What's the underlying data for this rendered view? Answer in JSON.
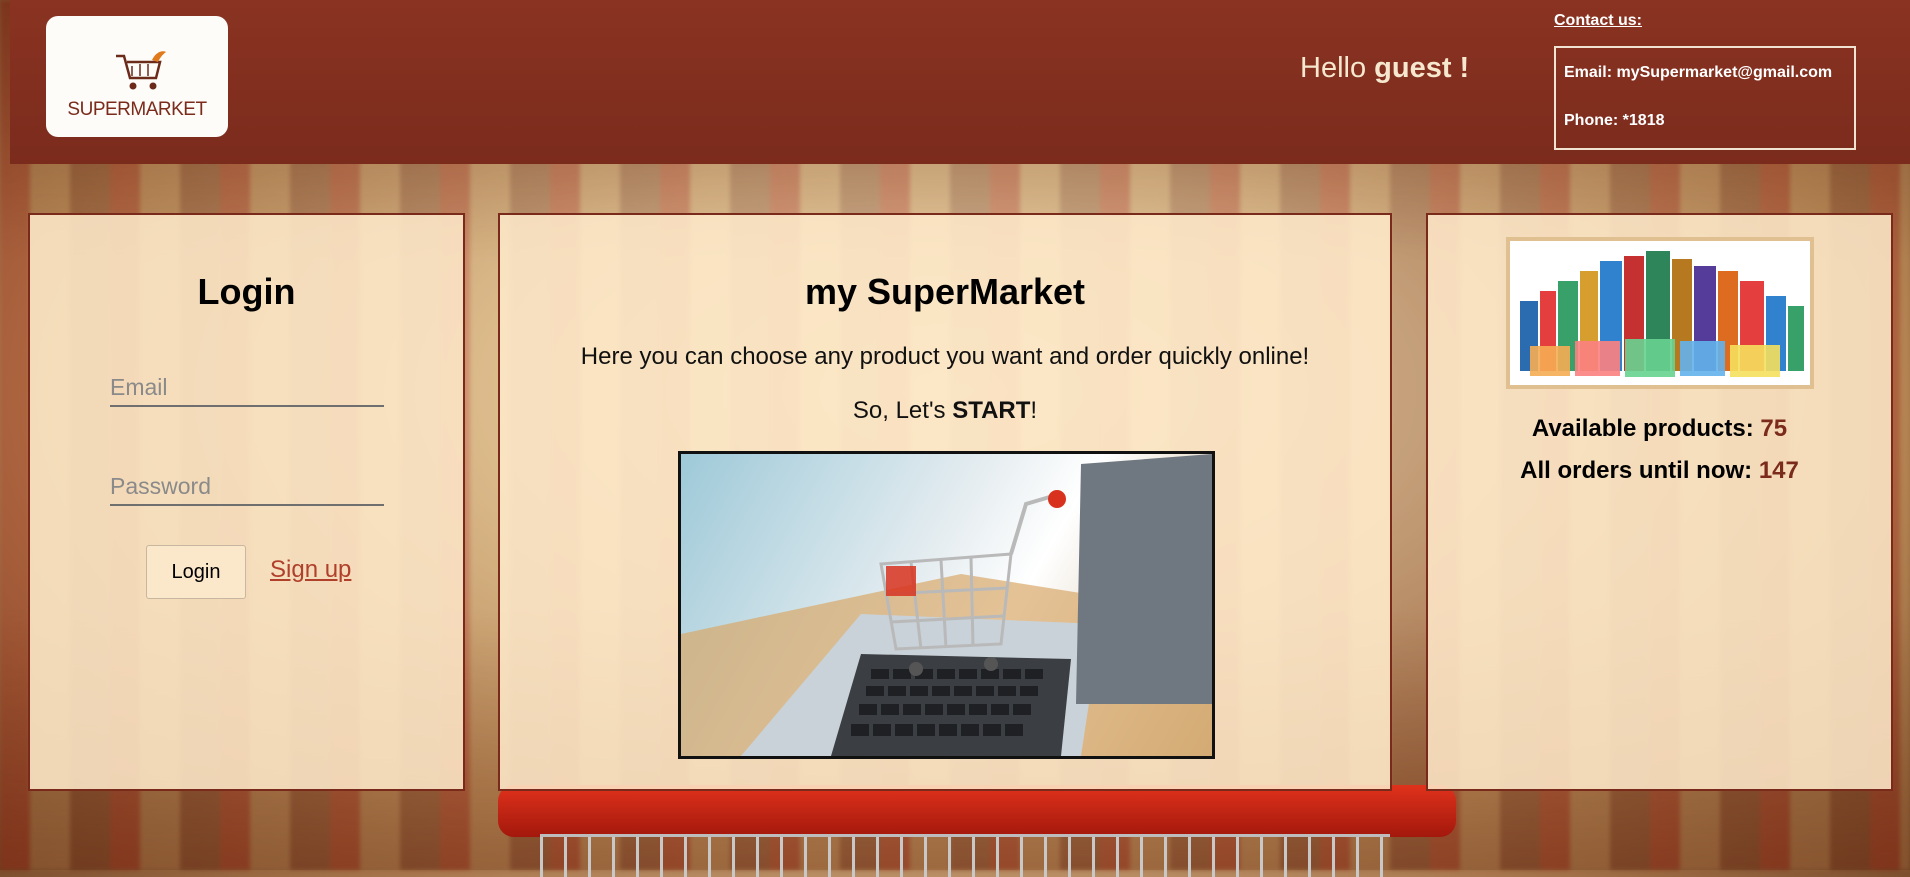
{
  "brand": {
    "logo_text": "SUPERMARKET"
  },
  "header": {
    "greeting_prefix": "Hello",
    "greeting_name": "guest !",
    "contact_label": "Contact us:",
    "email_line": "Email: mySupermarket@gmail.com",
    "phone_line": "Phone: *1818"
  },
  "login": {
    "title": "Login",
    "email_placeholder": "Email",
    "password_placeholder": "Password",
    "login_button": "Login",
    "signup_link": "Sign up"
  },
  "main": {
    "title": "my SuperMarket",
    "description": "Here you can choose any product you want and order quickly online!",
    "start_prefix": "So, Let's ",
    "start_bold": "START",
    "start_suffix": "!"
  },
  "stats": {
    "available_label": "Available products: ",
    "available_value": "75",
    "orders_label": "All orders until now: ",
    "orders_value": "147"
  },
  "colors": {
    "header": "#7b2b1c",
    "panel": "#fde8c8",
    "accent": "#b0402b"
  }
}
